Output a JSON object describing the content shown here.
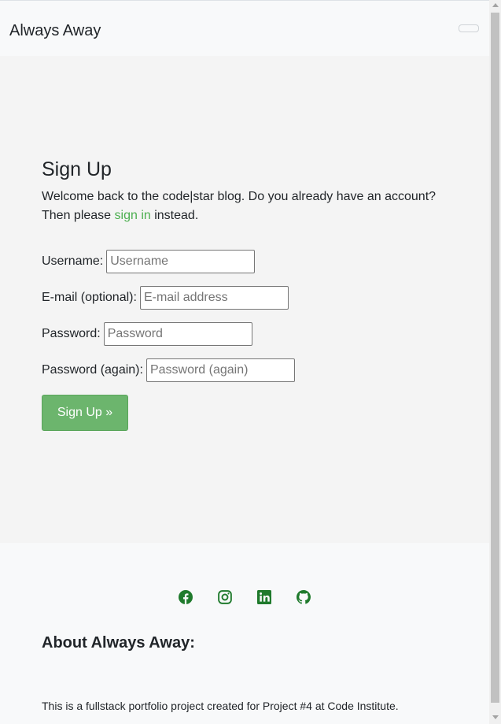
{
  "navbar": {
    "brand": "Always Away"
  },
  "signup": {
    "title": "Sign Up",
    "intro_text": "Welcome back to the code|star blog. Do you already have an account? Then please",
    "signin_link": "sign in",
    "intro_suffix": "instead.",
    "fields": {
      "username": {
        "label": "Username:",
        "placeholder": "Username"
      },
      "email": {
        "label": "E-mail (optional):",
        "placeholder": "E-mail address"
      },
      "password": {
        "label": "Password:",
        "placeholder": "Password"
      },
      "password2": {
        "label": "Password (again):",
        "placeholder": "Password (again)"
      }
    },
    "submit_label": "Sign Up »"
  },
  "footer": {
    "social": [
      "facebook-icon",
      "instagram-icon",
      "linkedin-icon",
      "github-icon"
    ],
    "about_title": "About Always Away:",
    "about_text": "This is a fullstack portfolio project created for Project #4 at Code Institute."
  },
  "colors": {
    "accent": "#4caf50",
    "button": "#6cb56d",
    "icons": "#1f7a2c"
  }
}
